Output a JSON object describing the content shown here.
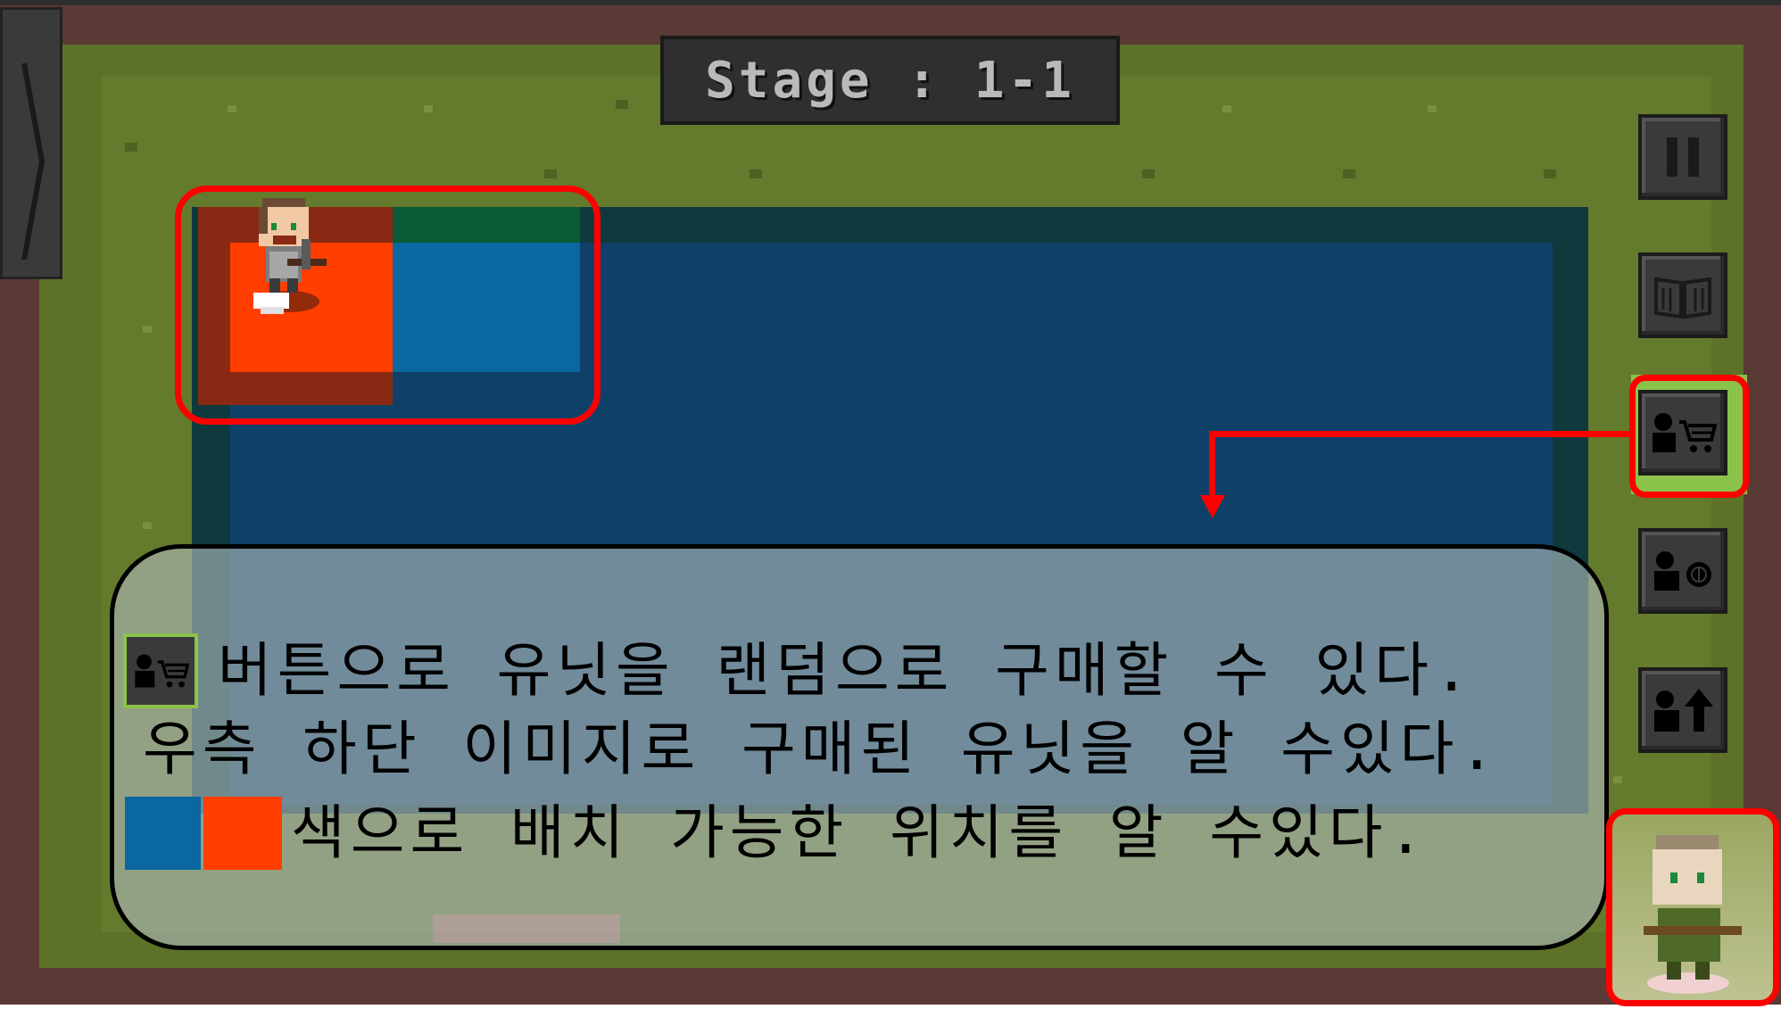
{
  "stage_title": "Stage : 1-1",
  "side_panel": {
    "toggle_icon": "chevron-right-icon"
  },
  "right_toolbar": {
    "buttons": [
      {
        "name": "pause",
        "icon": "pause-icon"
      },
      {
        "name": "book",
        "icon": "book-icon"
      },
      {
        "name": "buy-unit",
        "icon": "person-cart-icon",
        "highlighted": true
      },
      {
        "name": "sell-unit",
        "icon": "person-coin-icon"
      },
      {
        "name": "upgrade-unit",
        "icon": "person-up-arrow-icon"
      }
    ]
  },
  "tutorial": {
    "line1": "버튼으로 유닛을 랜덤으로 구매할 수 있다.",
    "line2": "우측 하단 이미지로 구매된 유닛을 알 수있다.",
    "line3": "색으로 배치 가능한 위치를 알 수있다."
  },
  "colors": {
    "placeable_blue": "#0a67a0",
    "placeable_orange": "#ff3e00",
    "highlight_red": "#ff0000",
    "grass": "#647a2c"
  }
}
